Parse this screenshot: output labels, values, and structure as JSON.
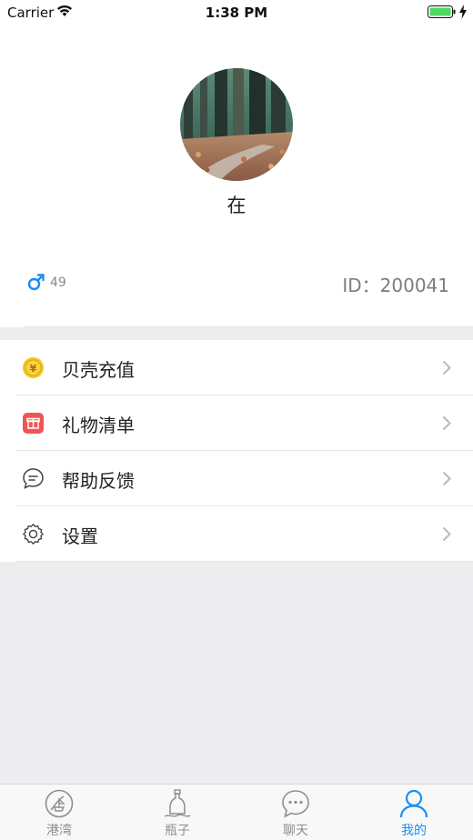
{
  "status_bar": {
    "carrier": "Carrier",
    "time": "1:38 PM",
    "icons": [
      "wifi-icon",
      "battery-icon",
      "charging-bolt-icon"
    ]
  },
  "profile": {
    "nickname": "在",
    "gender": "male",
    "age": "49",
    "id_label": "ID：",
    "id_value": "200041"
  },
  "menu": {
    "items": [
      {
        "label": "贝壳充值",
        "icon": "coin-icon"
      },
      {
        "label": "礼物清单",
        "icon": "gift-icon"
      },
      {
        "label": "帮助反馈",
        "icon": "feedback-chat-icon"
      },
      {
        "label": "设置",
        "icon": "settings-gear-icon"
      }
    ]
  },
  "tab_bar": {
    "tabs": [
      {
        "label": "港湾",
        "icon": "harbor-icon",
        "active": false
      },
      {
        "label": "瓶子",
        "icon": "bottle-icon",
        "active": false
      },
      {
        "label": "聊天",
        "icon": "chat-icon",
        "active": false
      },
      {
        "label": "我的",
        "icon": "profile-icon",
        "active": true
      }
    ]
  },
  "colors": {
    "accent": "#1a8ef3",
    "gender_male": "#1a8ef3",
    "coin": "#f5c518",
    "gift": "#f05454",
    "background": "#ededf0"
  }
}
